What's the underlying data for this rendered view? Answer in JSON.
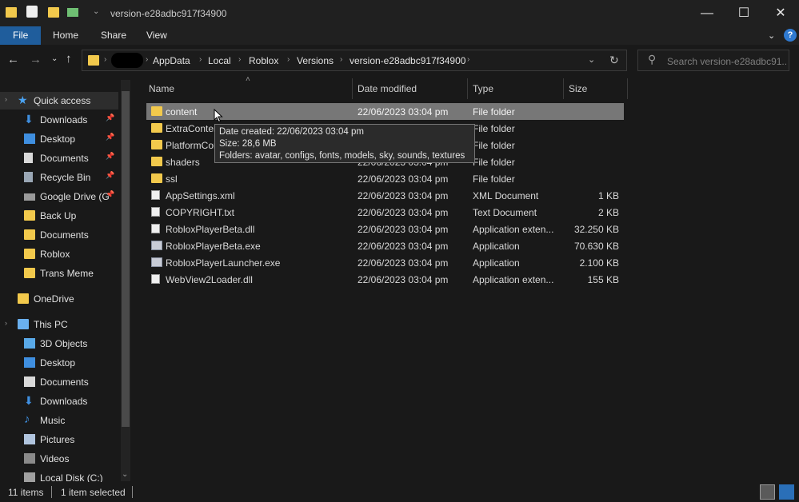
{
  "window": {
    "title": "version-e28adbc917f34900",
    "minimize": "—",
    "maximize": "☐",
    "close": "✕"
  },
  "ribbon": {
    "tabs": [
      "File",
      "Home",
      "Share",
      "View"
    ],
    "help": "?"
  },
  "address": {
    "crumbs": [
      "AppData",
      "Local",
      "Roblox",
      "Versions",
      "version-e28adbc917f34900"
    ],
    "search_placeholder": "Search version-e28adbc91..."
  },
  "nav": {
    "quick_access": "Quick access",
    "quick_items": [
      {
        "label": "Downloads",
        "icon": "download-arrow-icon",
        "pinned": true
      },
      {
        "label": "Desktop",
        "icon": "desktop-icon",
        "pinned": true
      },
      {
        "label": "Documents",
        "icon": "documents-icon",
        "pinned": true
      },
      {
        "label": "Recycle Bin",
        "icon": "recycle-bin-icon",
        "pinned": true
      },
      {
        "label": "Google Drive (G",
        "icon": "drive-icon",
        "pinned": true
      },
      {
        "label": "Back Up",
        "icon": "folder-icon",
        "pinned": false
      },
      {
        "label": "Documents",
        "icon": "folder-icon",
        "pinned": false
      },
      {
        "label": "Roblox",
        "icon": "folder-icon",
        "pinned": false
      },
      {
        "label": "Trans Meme",
        "icon": "folder-icon",
        "pinned": false
      }
    ],
    "onedrive": "OneDrive",
    "this_pc": "This PC",
    "pc_items": [
      {
        "label": "3D Objects",
        "icon": "3d-objects-icon"
      },
      {
        "label": "Desktop",
        "icon": "desktop-icon"
      },
      {
        "label": "Documents",
        "icon": "documents-icon"
      },
      {
        "label": "Downloads",
        "icon": "download-arrow-icon"
      },
      {
        "label": "Music",
        "icon": "music-icon"
      },
      {
        "label": "Pictures",
        "icon": "pictures-icon"
      },
      {
        "label": "Videos",
        "icon": "videos-icon"
      },
      {
        "label": "Local Disk (C:)",
        "icon": "disk-icon"
      }
    ]
  },
  "columns": {
    "name": "Name",
    "date": "Date modified",
    "type": "Type",
    "size": "Size"
  },
  "files": [
    {
      "name": "content",
      "date": "22/06/2023 03:04 pm",
      "type": "File folder",
      "size": "",
      "kind": "folder",
      "selected": true
    },
    {
      "name": "ExtraContent",
      "date": "22/06/2023 03:04 pm",
      "type": "File folder",
      "size": "",
      "kind": "folder"
    },
    {
      "name": "PlatformContent",
      "date": "22/06/2023 03:04 pm",
      "type": "File folder",
      "size": "",
      "kind": "folder"
    },
    {
      "name": "shaders",
      "date": "22/06/2023 03:04 pm",
      "type": "File folder",
      "size": "",
      "kind": "folder"
    },
    {
      "name": "ssl",
      "date": "22/06/2023 03:04 pm",
      "type": "File folder",
      "size": "",
      "kind": "folder"
    },
    {
      "name": "AppSettings.xml",
      "date": "22/06/2023 03:04 pm",
      "type": "XML Document",
      "size": "1 KB",
      "kind": "file"
    },
    {
      "name": "COPYRIGHT.txt",
      "date": "22/06/2023 03:04 pm",
      "type": "Text Document",
      "size": "2 KB",
      "kind": "file"
    },
    {
      "name": "RobloxPlayerBeta.dll",
      "date": "22/06/2023 03:04 pm",
      "type": "Application exten...",
      "size": "32.250 KB",
      "kind": "dll"
    },
    {
      "name": "RobloxPlayerBeta.exe",
      "date": "22/06/2023 03:04 pm",
      "type": "Application",
      "size": "70.630 KB",
      "kind": "exe"
    },
    {
      "name": "RobloxPlayerLauncher.exe",
      "date": "22/06/2023 03:04 pm",
      "type": "Application",
      "size": "2.100 KB",
      "kind": "exe"
    },
    {
      "name": "WebView2Loader.dll",
      "date": "22/06/2023 03:04 pm",
      "type": "Application exten...",
      "size": "155 KB",
      "kind": "dll"
    }
  ],
  "tooltip": {
    "created": "Date created: 22/06/2023 03:04 pm",
    "size": "Size: 28,6 MB",
    "folders": "Folders: avatar, configs, fonts, models, sky, sounds, textures"
  },
  "status": {
    "items": "11 items",
    "selected": "1 item selected"
  },
  "colors": {
    "folder": "#f2c94c",
    "accent": "#1f5d9c",
    "selection": "#777777"
  }
}
